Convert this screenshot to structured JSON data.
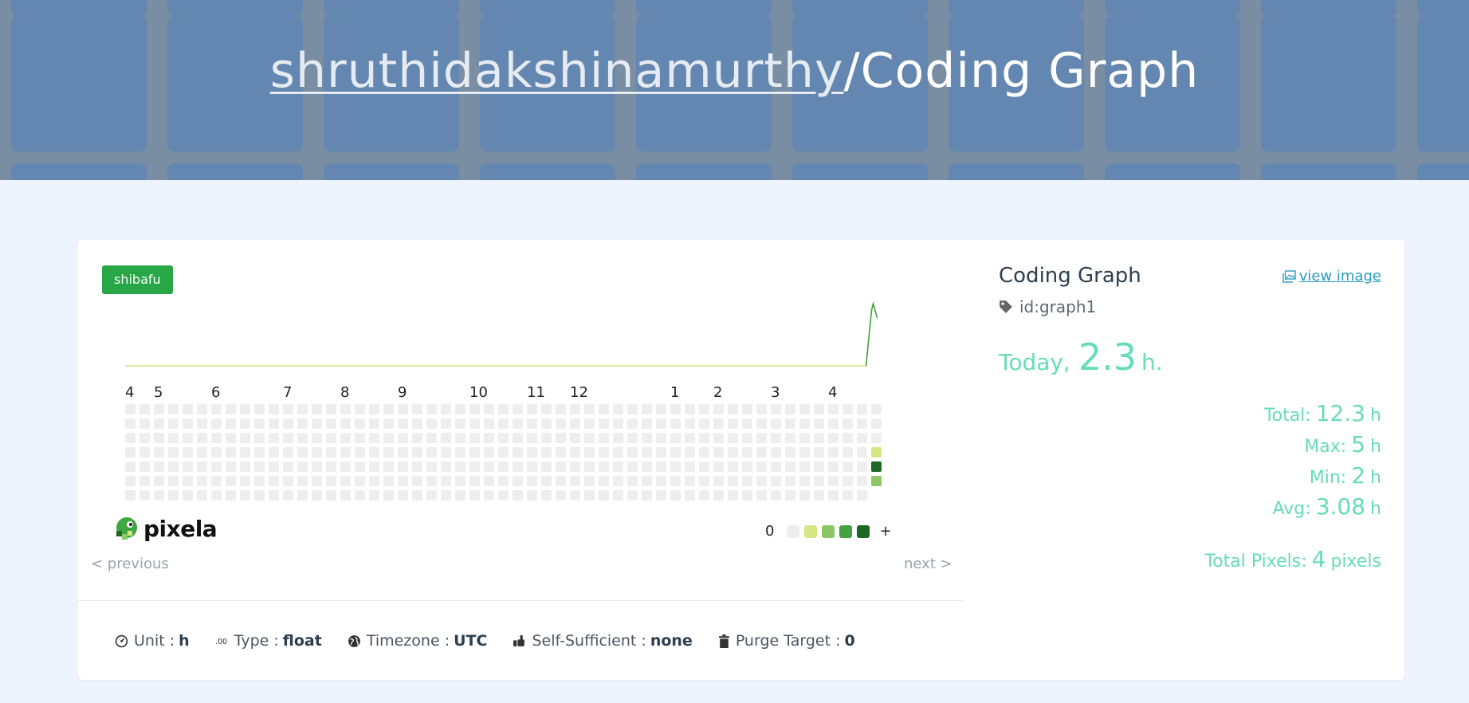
{
  "header": {
    "owner": "shruthidakshinamurthy",
    "separator": "/",
    "graph_name": "Coding Graph"
  },
  "badge": "shibafu",
  "graph": {
    "month_labels": [
      "4",
      "5",
      "6",
      "7",
      "8",
      "9",
      "10",
      "11",
      "12",
      "1",
      "2",
      "3",
      "4"
    ],
    "pixel_values": [
      2,
      5,
      3
    ],
    "legend": {
      "low": "0",
      "high": "+"
    },
    "colors": {
      "empty": "#eeeeee",
      "level1": "#d6e685",
      "level2": "#8cc665",
      "level3": "#44a340",
      "level4": "#1e6823",
      "line": "#d6e685"
    },
    "logo_text": "pixela"
  },
  "nav": {
    "previous": "< previous",
    "next": "next >"
  },
  "meta": {
    "unit_label": "Unit",
    "unit_value": "h",
    "type_label": "Type",
    "type_value": "float",
    "timezone_label": "Timezone",
    "timezone_value": "UTC",
    "self_label": "Self-Sufficient",
    "self_value": "none",
    "purge_label": "Purge Target",
    "purge_value": "0",
    "colon": ":"
  },
  "side": {
    "title": "Coding Graph",
    "view_image": "view image",
    "id_label": "id:graph1",
    "today_label": "Today,",
    "today_value": "2.3",
    "today_unit": "h.",
    "stats": {
      "total_label": "Total:",
      "total_value": "12.3",
      "max_label": "Max:",
      "max_value": "5",
      "min_label": "Min:",
      "min_value": "2",
      "avg_label": "Avg:",
      "avg_value": "3.08",
      "unit": "h"
    },
    "total_pixels_label": "Total Pixels:",
    "total_pixels_value": "4",
    "total_pixels_unit": "pixels"
  },
  "theme": {
    "accent": "#66dcb8",
    "badge": "#27a745",
    "link": "#2b9bc3"
  }
}
